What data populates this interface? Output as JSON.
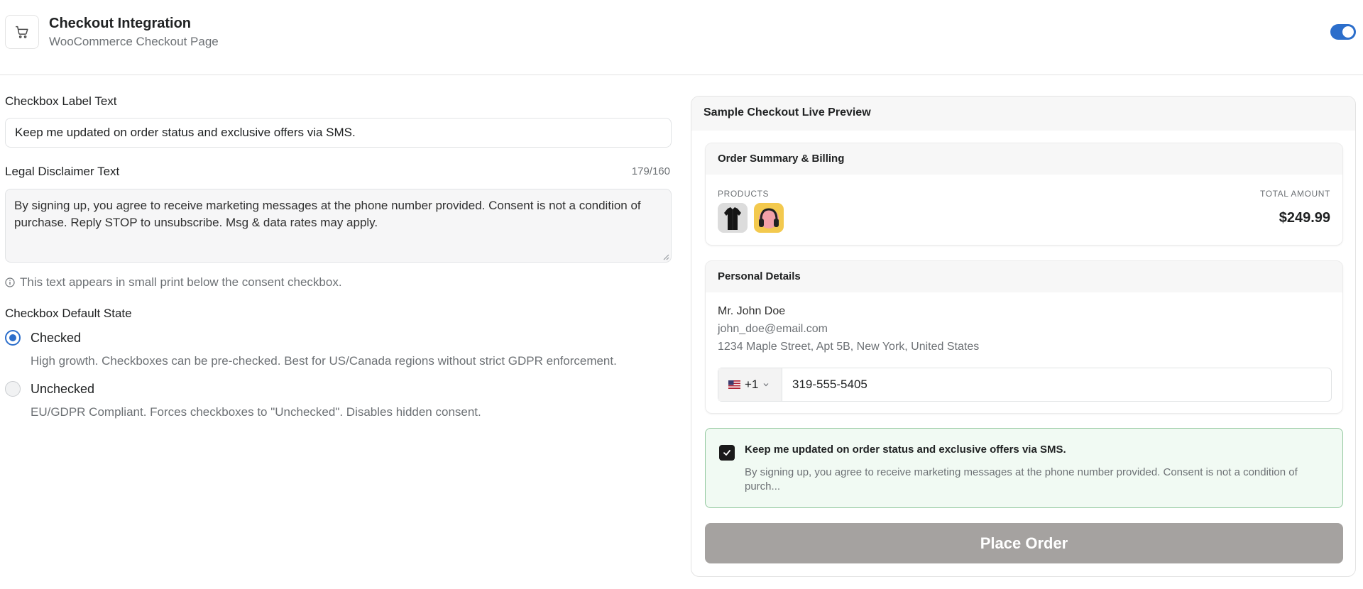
{
  "header": {
    "icon": "shopping-cart-icon",
    "title": "Checkout Integration",
    "subtitle": "WooCommerce Checkout Page",
    "toggle_on": true,
    "accent_color": "#2c6ecb"
  },
  "form": {
    "checkbox_label": {
      "label": "Checkbox Label Text",
      "value": "Keep me updated on order status and exclusive offers via SMS."
    },
    "disclaimer": {
      "label": "Legal Disclaimer Text",
      "counter": "179/160",
      "value": "By signing up, you agree to receive marketing messages at the phone number provided. Consent is not a condition of purchase. Reply STOP to unsubscribe. Msg & data rates may apply.",
      "hint": "This text appears in small print below the consent checkbox."
    },
    "default_state": {
      "label": "Checkbox Default State",
      "options": [
        {
          "label": "Checked",
          "description": "High growth. Checkboxes can be pre-checked. Best for US/Canada regions without strict GDPR enforcement.",
          "selected": true
        },
        {
          "label": "Unchecked",
          "description": "EU/GDPR Compliant. Forces checkboxes to \"Unchecked\". Disables hidden consent.",
          "selected": false
        }
      ]
    }
  },
  "preview": {
    "title": "Sample Checkout Live Preview",
    "order_summary": {
      "title": "Order Summary & Billing",
      "products_caption": "PRODUCTS",
      "total_caption": "TOTAL AMOUNT",
      "total": "$249.99",
      "products": [
        "black-shirt-thumbnail",
        "headphones-thumbnail"
      ]
    },
    "personal_details": {
      "title": "Personal Details",
      "name": "Mr. John Doe",
      "email": "john_doe@email.com",
      "address": "1234 Maple Street, Apt 5B, New York, United States",
      "country_flag": "us-flag-icon",
      "dial_code": "+1",
      "phone": "319-555-5405"
    },
    "consent": {
      "checked": true,
      "label": "Keep me updated on order status and exclusive offers via SMS.",
      "text": "By signing up, you agree to receive marketing messages at the phone number provided. Consent is not a condition of purch..."
    },
    "place_order_label": "Place Order"
  }
}
